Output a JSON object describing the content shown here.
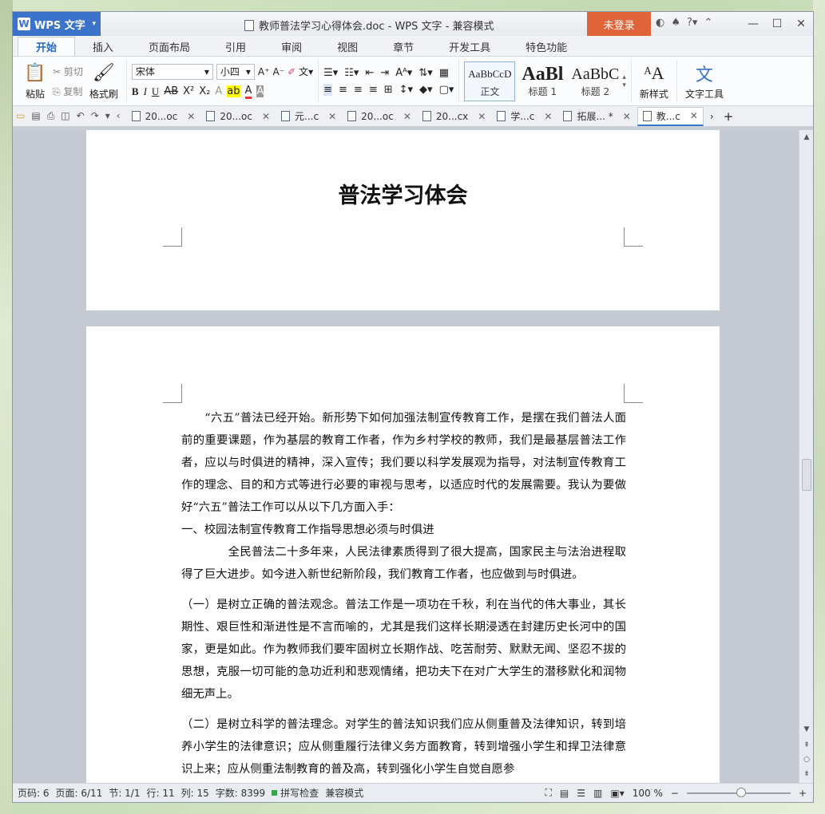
{
  "titlebar": {
    "app_name": "WPS 文字",
    "doc_title": "教师普法学习心得体会.doc - WPS 文字 - 兼容模式",
    "login": "未登录"
  },
  "menu": [
    "开始",
    "插入",
    "页面布局",
    "引用",
    "审阅",
    "视图",
    "章节",
    "开发工具",
    "特色功能"
  ],
  "ribbon": {
    "paste": "粘贴",
    "cut": "剪切",
    "copy": "复制",
    "format_painter": "格式刷",
    "font_name": "宋体",
    "font_size": "小四",
    "styles": [
      {
        "sample": "AaBbCcD",
        "name": "正文"
      },
      {
        "sample": "AaBl",
        "name": "标题 1"
      },
      {
        "sample": "AaBbC",
        "name": "标题 2"
      }
    ],
    "new_style": "新样式",
    "text_tools": "文字工具"
  },
  "doc_tabs": [
    "20...oc",
    "20...oc",
    "元...c",
    "20...oc",
    "20...cx",
    "学...c",
    "拓展... *",
    "教...c"
  ],
  "document": {
    "heading": "普法学习体会",
    "paragraphs": [
      "　　“六五”普法已经开始。新形势下如何加强法制宣传教育工作，是摆在我们普法人面前的重要课题，作为基层的教育工作者，作为乡村学校的教师，我们是最基层普法工作者，应以与时俱进的精神，深入宣传；我们要以科学发展观为指导，对法制宣传教育工作的理念、目的和方式等进行必要的审视与思考，以适应时代的发展需要。我认为要做好“六五”普法工作可以从以下几方面入手：",
      "一、校园法制宣传教育工作指导思想必须与时俱进",
      "　　　　全民普法二十多年来，人民法律素质得到了很大提高，国家民主与法治进程取得了巨大进步。如今进入新世纪新阶段，我们教育工作者，也应做到与时俱进。",
      "（一）是树立正确的普法观念。普法工作是一项功在千秋，利在当代的伟大事业，其长期性、艰巨性和渐进性是不言而喻的，尤其是我们这样长期浸透在封建历史长河中的国家，更是如此。作为教师我们要牢固树立长期作战、吃苦耐劳、默默无闻、坚忍不拔的思想，克服一切可能的急功近利和悲观情绪，把功夫下在对广大学生的潜移默化和润物细无声上。",
      "（二）是树立科学的普法理念。对学生的普法知识我们应从侧重普及法律知识，转到培养小学生的法律意识；应从侧重履行法律义务方面教育，转到增强小学生和捍卫法律意识上来；应从侧重法制教育的普及高，转到强化小学生自觉自愿参"
    ]
  },
  "status": {
    "page_num": "页码: 6",
    "page": "页面: 6/11",
    "section": "节: 1/1",
    "row": "行: 11",
    "col": "列: 15",
    "words": "字数: 8399",
    "spell": "拼写检查",
    "mode": "兼容模式",
    "zoom": "100 %"
  }
}
